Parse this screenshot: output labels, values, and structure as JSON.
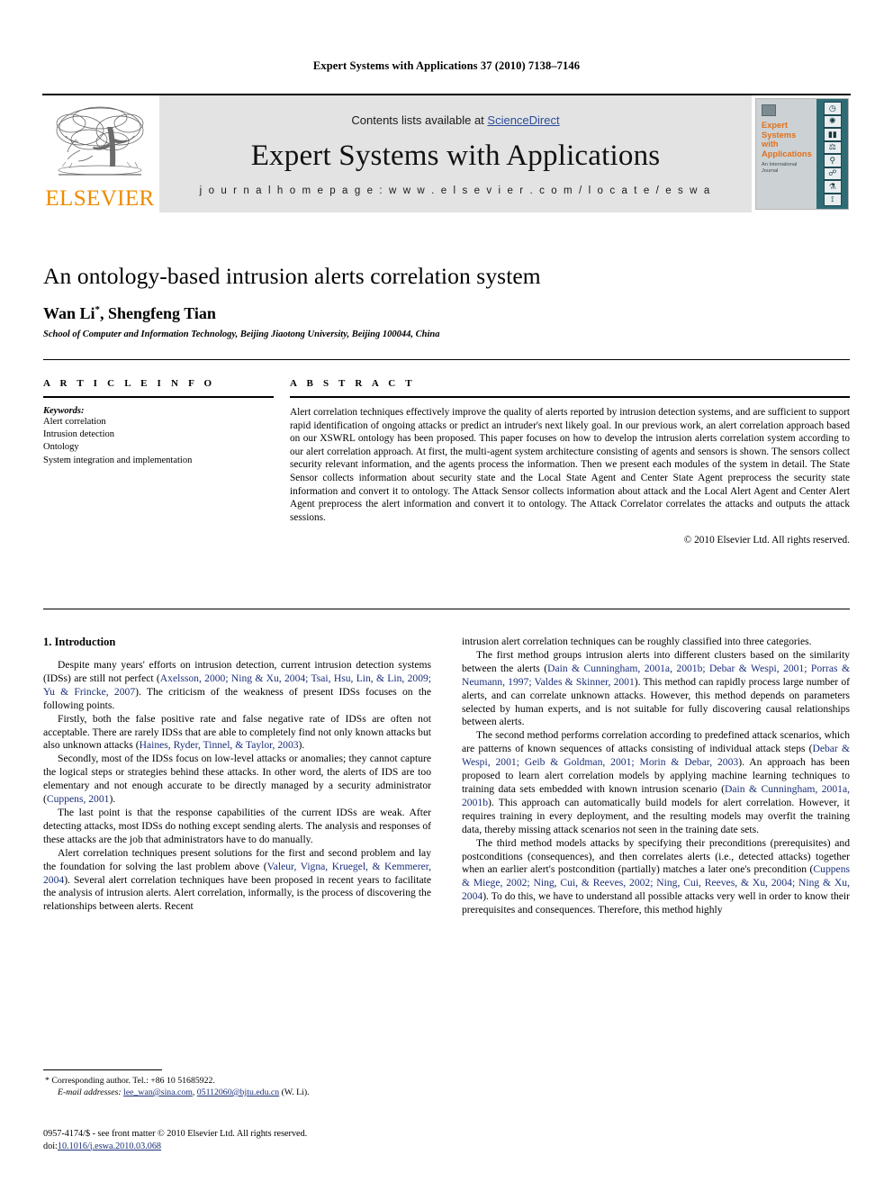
{
  "running_head": "Expert Systems with Applications 37 (2010) 7138–7146",
  "masthead": {
    "publisher_word": "ELSEVIER",
    "contents_prefix": "Contents lists available at ",
    "contents_link": "ScienceDirect",
    "journal_title": "Expert Systems with Applications",
    "homepage": "j o u r n a l   h o m e p a g e :   w w w . e l s e v i e r . c o m / l o c a t e / e s w a",
    "cover": {
      "title": "Expert Systems with Applications",
      "subtitle": "An International Journal",
      "icons": [
        "clock-icon",
        "gear-icon",
        "bar-chart-icon",
        "scales-icon",
        "microscope-icon",
        "handshake-icon",
        "flask-icon",
        "drill-icon"
      ]
    }
  },
  "article": {
    "title": "An ontology-based intrusion alerts correlation system",
    "authors": "Wan Li",
    "author_marker": "*",
    "authors_rest": ", Shengfeng Tian",
    "affiliation": "School of Computer and Information Technology, Beijing Jiaotong University, Beijing 100044, China"
  },
  "article_info": {
    "heading": "A R T I C L E   I N F O",
    "keywords_label": "Keywords:",
    "keywords": [
      "Alert correlation",
      "Intrusion detection",
      "Ontology",
      "System integration and implementation"
    ]
  },
  "abstract": {
    "heading": "A B S T R A C T",
    "text": "Alert correlation techniques effectively improve the quality of alerts reported by intrusion detection systems, and are sufficient to support rapid identification of ongoing attacks or predict an intruder's next likely goal. In our previous work, an alert correlation approach based on our XSWRL ontology has been proposed. This paper focuses on how to develop the intrusion alerts correlation system according to our alert correlation approach. At first, the multi-agent system architecture consisting of agents and sensors is shown. The sensors collect security relevant information, and the agents process the information. Then we present each modules of the system in detail. The State Sensor collects information about security state and the Local State Agent and Center State Agent preprocess the security state information and convert it to ontology. The Attack Sensor collects information about attack and the Local Alert Agent and Center Alert Agent preprocess the alert information and convert it to ontology. The Attack Correlator correlates the attacks and outputs the attack sessions.",
    "copyright": "© 2010 Elsevier Ltd. All rights reserved."
  },
  "body": {
    "section_title": "1. Introduction",
    "left_paragraphs": [
      "Despite many years' efforts on intrusion detection, current intrusion detection systems (IDSs) are still not perfect (Axelsson, 2000; Ning & Xu, 2004; Tsai, Hsu, Lin, & Lin, 2009; Yu & Frincke, 2007). The criticism of the weakness of present IDSs focuses on the following points.",
      "Firstly, both the false positive rate and false negative rate of IDSs are often not acceptable. There are rarely IDSs that are able to completely find not only known attacks but also unknown attacks (Haines, Ryder, Tinnel, & Taylor, 2003).",
      "Secondly, most of the IDSs focus on low-level attacks or anomalies; they cannot capture the logical steps or strategies behind these attacks. In other word, the alerts of IDS are too elementary and not enough accurate to be directly managed by a security administrator (Cuppens, 2001).",
      "The last point is that the response capabilities of the current IDSs are weak. After detecting attacks, most IDSs do nothing except sending alerts. The analysis and responses of these attacks are the job that administrators have to do manually.",
      "Alert correlation techniques present solutions for the first and second problem and lay the foundation for solving the last problem above (Valeur, Vigna, Kruegel, & Kemmerer, 2004). Several alert correlation techniques have been proposed in recent years to facilitate the analysis of intrusion alerts. Alert correlation, informally, is the process of discovering the relationships between alerts. Recent"
    ],
    "right_paragraphs": [
      "intrusion alert correlation techniques can be roughly classified into three categories.",
      "The first method groups intrusion alerts into different clusters based on the similarity between the alerts (Dain & Cunningham, 2001a, 2001b; Debar & Wespi, 2001; Porras & Neumann, 1997; Valdes & Skinner, 2001). This method can rapidly process large number of alerts, and can correlate unknown attacks. However, this method depends on parameters selected by human experts, and is not suitable for fully discovering causal relationships between alerts.",
      "The second method performs correlation according to predefined attack scenarios, which are patterns of known sequences of attacks consisting of individual attack steps (Debar & Wespi, 2001; Geib & Goldman, 2001; Morin & Debar, 2003). An approach has been proposed to learn alert correlation models by applying machine learning techniques to training data sets embedded with known intrusion scenario (Dain & Cunningham, 2001a, 2001b). This approach can automatically build models for alert correlation. However, it requires training in every deployment, and the resulting models may overfit the training data, thereby missing attack scenarios not seen in the training date sets.",
      "The third method models attacks by specifying their preconditions (prerequisites) and postconditions (consequences), and then correlates alerts (i.e., detected attacks) together when an earlier alert's postcondition (partially) matches a later one's precondition (Cuppens & Miege, 2002; Ning, Cui, & Reeves, 2002; Ning, Cui, Reeves, & Xu, 2004; Ning & Xu, 2004). To do this, we have to understand all possible attacks very well in order to know their prerequisites and consequences. Therefore, this method highly"
    ]
  },
  "footnote": {
    "marker": "*",
    "corresponding": "Corresponding author. Tel.: +86 10 51685922.",
    "email_label": "E-mail addresses:",
    "email1": "lee_wan@sina.com",
    "email_sep": ", ",
    "email2": "05112060@bjtu.edu.cn",
    "email_suffix": " (W. Li)."
  },
  "imprint": {
    "line1": "0957-4174/$ - see front matter © 2010 Elsevier Ltd. All rights reserved.",
    "doi_label": "doi:",
    "doi_value": "10.1016/j.eswa.2010.03.068"
  },
  "colors": {
    "elsevier_orange": "#ED8B00",
    "link_blue": "#2b4b9b",
    "citation_blue": "#1b2f7a",
    "banner_gray": "#e3e3e3",
    "cover_teal": "#2e6b75"
  }
}
